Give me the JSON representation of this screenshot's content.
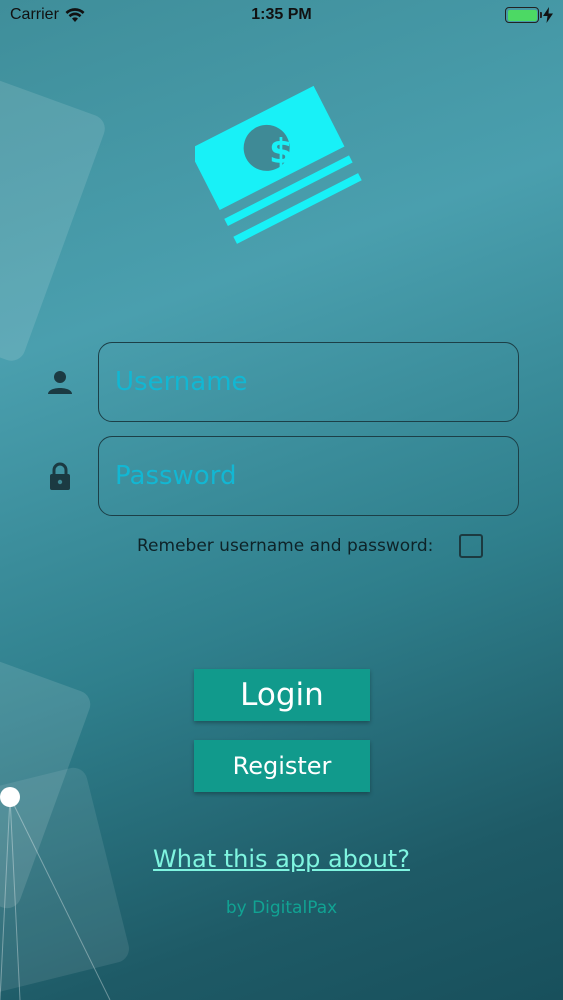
{
  "status_bar": {
    "carrier": "Carrier",
    "time": "1:35 PM",
    "battery_level": 1.0
  },
  "logo": {
    "icon": "money-stack-icon",
    "symbol": "$",
    "color": "#18f1f7"
  },
  "form": {
    "username": {
      "placeholder": "Username",
      "value": "",
      "icon": "user-icon"
    },
    "password": {
      "placeholder": "Password",
      "value": "",
      "icon": "lock-icon"
    },
    "remember_label": "Remeber username and password:",
    "remember_checked": false
  },
  "buttons": {
    "login": "Login",
    "register": "Register"
  },
  "about_link": "What this app about?",
  "footer": "by DigitalPax",
  "colors": {
    "accent": "#119a8c",
    "link": "#7ff5e0",
    "input_text": "#12b7d3"
  }
}
